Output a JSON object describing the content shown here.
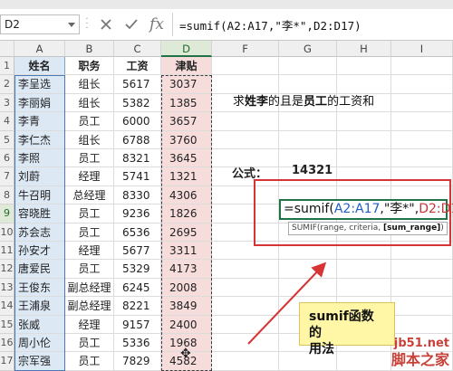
{
  "formula_bar": {
    "name_box": "D2",
    "cancel_icon": "close-icon",
    "enter_icon": "check-icon",
    "fx_label": "fx",
    "formula": "=sumif(A2:A17,\"李*\",D2:D17)"
  },
  "columns": [
    "A",
    "B",
    "C",
    "D",
    "F",
    "G",
    "H",
    "I"
  ],
  "rows": [
    "1",
    "2",
    "3",
    "4",
    "5",
    "6",
    "7",
    "8",
    "9",
    "10",
    "11",
    "12",
    "13",
    "14",
    "15",
    "16",
    "17"
  ],
  "table": {
    "headers": [
      "姓名",
      "职务",
      "工资",
      "津贴"
    ],
    "rows": [
      [
        "李呈选",
        "组长",
        "5617",
        "3037"
      ],
      [
        "李丽娟",
        "组长",
        "5382",
        "1385"
      ],
      [
        "李青",
        "员工",
        "6000",
        "3657"
      ],
      [
        "李仁杰",
        "组长",
        "6788",
        "3760"
      ],
      [
        "李照",
        "员工",
        "8321",
        "3645"
      ],
      [
        "刘蔚",
        "经理",
        "5741",
        "1321"
      ],
      [
        "牛召明",
        "总经理",
        "8330",
        "4306"
      ],
      [
        "容晓胜",
        "员工",
        "9236",
        "1826"
      ],
      [
        "苏会志",
        "员工",
        "6536",
        "2695"
      ],
      [
        "孙安才",
        "经理",
        "5677",
        "3311"
      ],
      [
        "唐爱民",
        "员工",
        "5329",
        "4173"
      ],
      [
        "王俊东",
        "副总经理",
        "6245",
        "2008"
      ],
      [
        "王浦泉",
        "副总经理",
        "8221",
        "3849"
      ],
      [
        "张威",
        "经理",
        "9157",
        "2400"
      ],
      [
        "周小伦",
        "员工",
        "5336",
        "1968"
      ],
      [
        "宗军强",
        "员工",
        "7829",
        "4582"
      ]
    ]
  },
  "question": {
    "p1": "求",
    "p2": "姓李",
    "p3": "的且是",
    "p4": "员工",
    "p5": "的工资和"
  },
  "formula_label": "公式：",
  "formula_result": "14321",
  "edit_cell": {
    "prefix": "=sumif(",
    "range1": "A2:A17",
    "mid": ",\"李*\",",
    "range2": "D2:D17",
    "suffix": ")"
  },
  "tooltip": {
    "text": "SUMIF(range, criteria, ",
    "bold": "[sum_range]",
    "end": ")"
  },
  "callout": {
    "line1": "sumif函数的",
    "line2": "用法"
  },
  "watermark": {
    "url": "jb51.net",
    "cn": "脚本之家"
  },
  "colors": {
    "accent_green": "#217346",
    "red_highlight": "#d73535",
    "name_column": "#dde8f5",
    "allowance_column": "#f7dcdc",
    "callout": "#fff6a6"
  }
}
